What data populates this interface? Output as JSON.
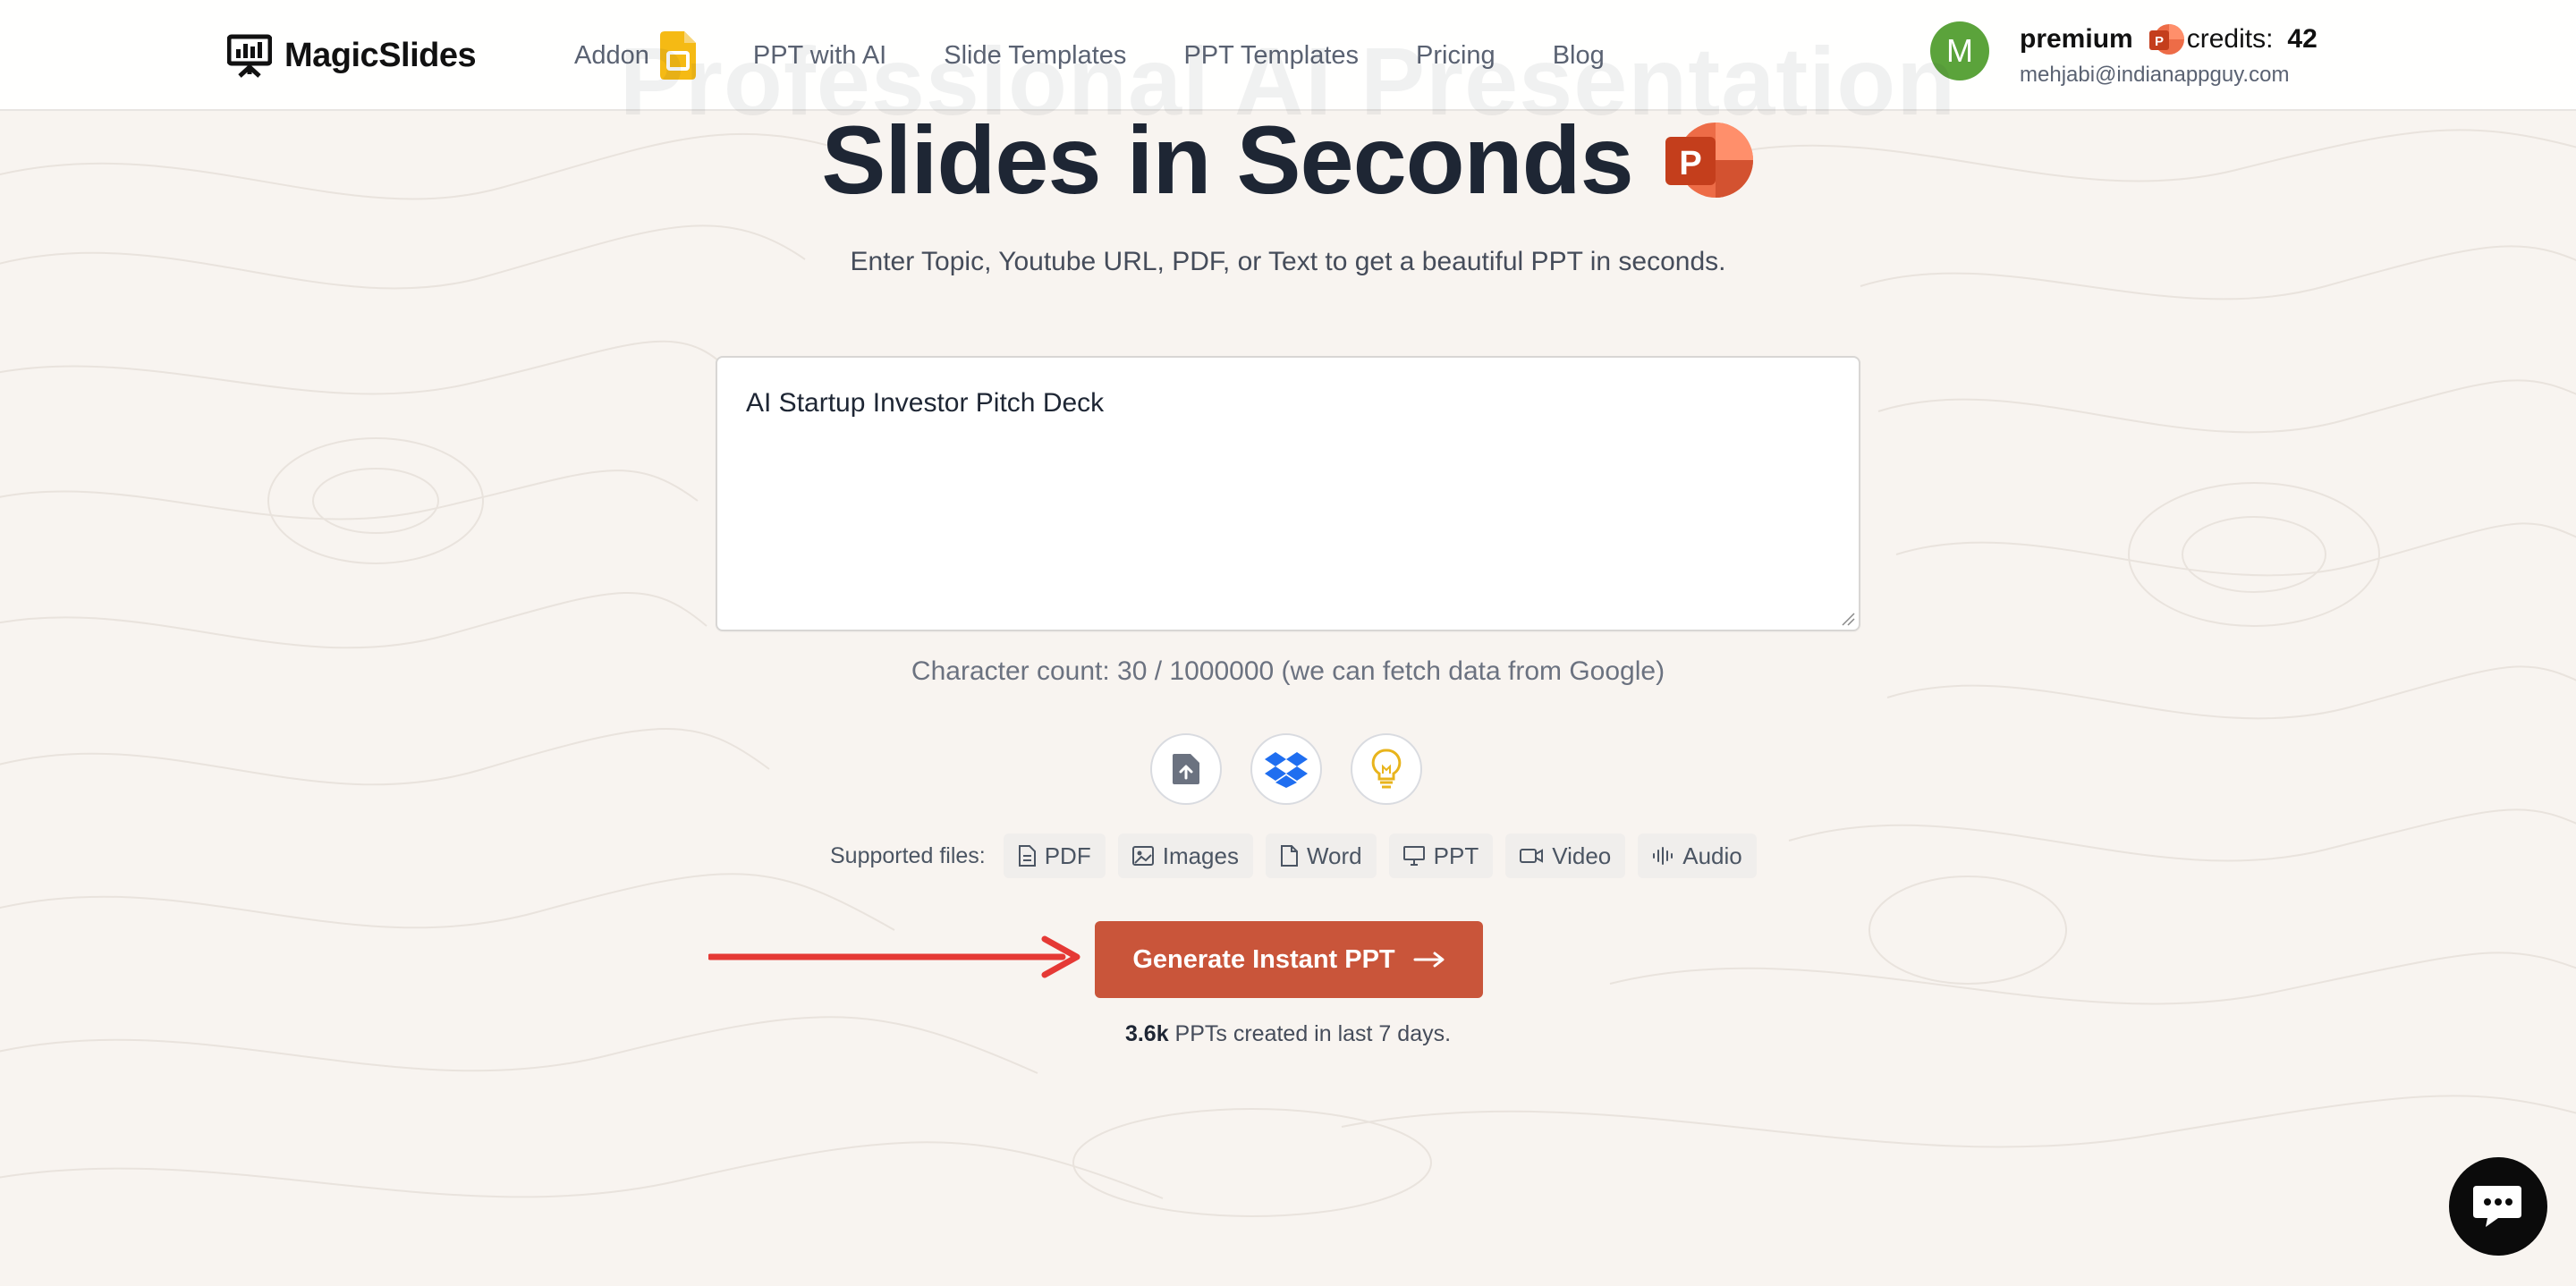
{
  "header": {
    "logo_text": "MagicSlides",
    "nav": [
      {
        "label": "Addon"
      },
      {
        "label": "PPT with AI"
      },
      {
        "label": "Slide Templates"
      },
      {
        "label": "PPT Templates"
      },
      {
        "label": "Pricing"
      },
      {
        "label": "Blog"
      }
    ],
    "user": {
      "avatar_initial": "M",
      "plan": "premium",
      "credits_label": "credits:",
      "credits_value": "42",
      "email": "mehjabi@indianappguy.com"
    }
  },
  "hero": {
    "ghost_title": "Professional AI Presentation",
    "title": "Slides in Seconds",
    "subtitle": "Enter Topic, Youtube URL, PDF, or Text to get a beautiful PPT in seconds."
  },
  "input": {
    "value": "AI Startup Investor Pitch Deck"
  },
  "char_count": "Character count: 30 / 1000000 (we can fetch data from Google)",
  "supported": {
    "label": "Supported files:",
    "types": [
      {
        "label": "PDF",
        "icon": "file-text-icon"
      },
      {
        "label": "Images",
        "icon": "image-icon"
      },
      {
        "label": "Word",
        "icon": "file-icon"
      },
      {
        "label": "PPT",
        "icon": "presentation-icon"
      },
      {
        "label": "Video",
        "icon": "video-icon"
      },
      {
        "label": "Audio",
        "icon": "audio-wave-icon"
      }
    ]
  },
  "generate_button": {
    "label": "Generate Instant PPT",
    "color": "#c9553a"
  },
  "stats": {
    "count": "3.6k",
    "text": " PPTs created in last 7 days."
  },
  "colors": {
    "background": "#f8f4f0",
    "accent": "#c9553a",
    "arrow": "#e53935",
    "avatar": "#5ba33b"
  }
}
